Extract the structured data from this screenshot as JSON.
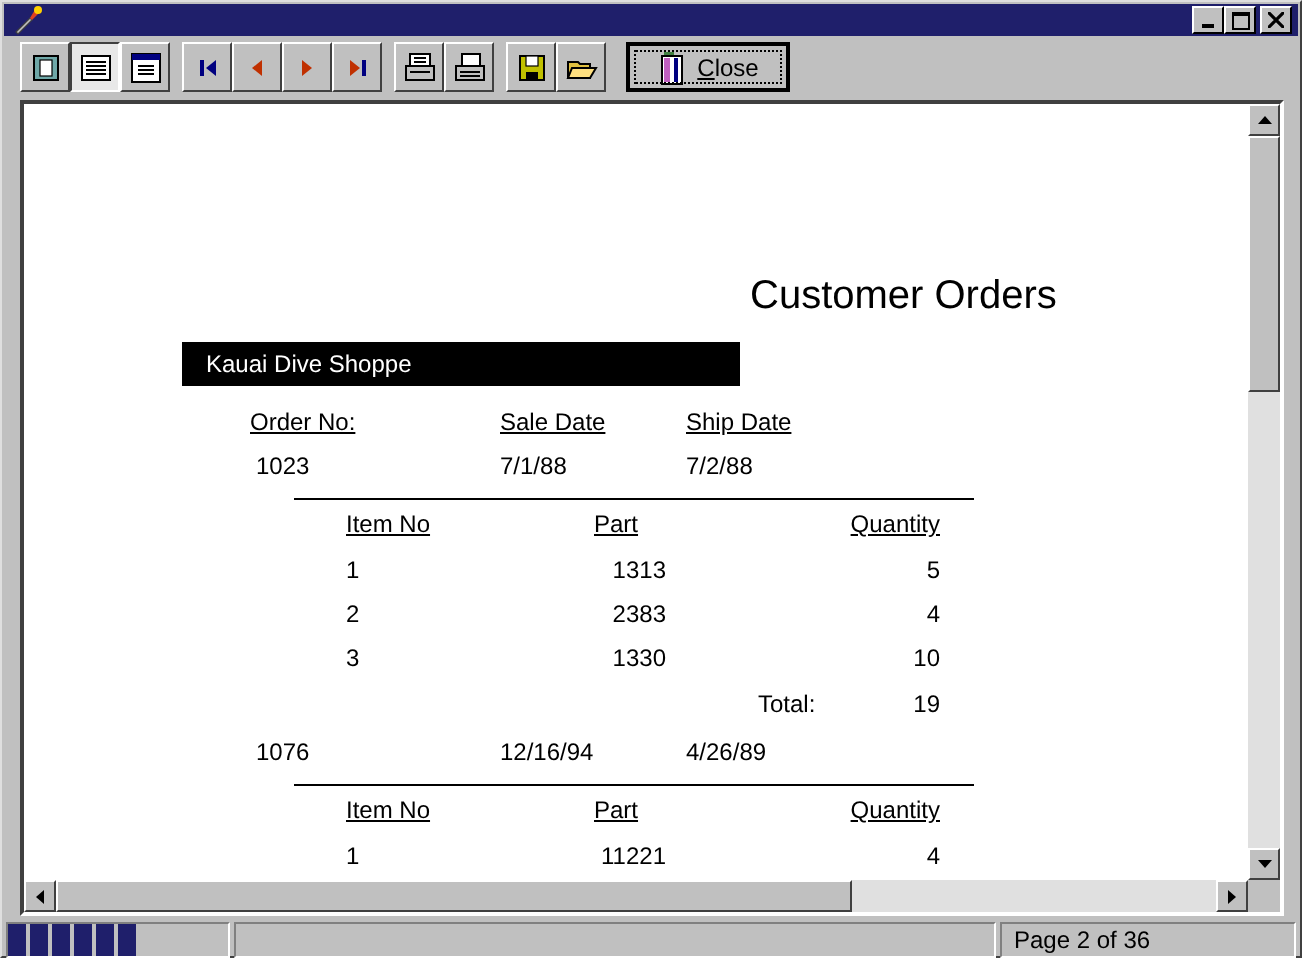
{
  "toolbar": {
    "groups": [
      [
        {
          "kind": "whole-page",
          "selected": false
        },
        {
          "kind": "page-width",
          "selected": true
        },
        {
          "kind": "zoom",
          "selected": false
        }
      ],
      [
        {
          "kind": "first"
        },
        {
          "kind": "prev"
        },
        {
          "kind": "next"
        },
        {
          "kind": "last"
        }
      ],
      [
        {
          "kind": "print-setup"
        },
        {
          "kind": "print"
        }
      ],
      [
        {
          "kind": "save"
        },
        {
          "kind": "open"
        }
      ]
    ],
    "close": {
      "label": "Close"
    }
  },
  "report": {
    "title": "Customer Orders",
    "customer": "Kauai Dive Shoppe",
    "order_columns": [
      "Order No:",
      "Sale Date",
      "Ship Date"
    ],
    "orders": [
      {
        "order_no": "1023",
        "sale_date": "7/1/88",
        "ship_date": "7/2/88",
        "item_columns": [
          "Item No",
          "Part",
          "Quantity"
        ],
        "items": [
          {
            "item_no": "1",
            "part": "1313",
            "quantity": "5"
          },
          {
            "item_no": "2",
            "part": "2383",
            "quantity": "4"
          },
          {
            "item_no": "3",
            "part": "1330",
            "quantity": "10"
          }
        ],
        "total": {
          "label": "Total:",
          "value": "19"
        }
      },
      {
        "order_no": "1076",
        "sale_date": "12/16/94",
        "ship_date": "4/26/89",
        "item_columns": [
          "Item No",
          "Part",
          "Quantity"
        ],
        "items": [
          {
            "item_no": "1",
            "part": "11221",
            "quantity": "4"
          }
        ]
      }
    ]
  },
  "status_bar": {
    "progress": {
      "level": 0.6
    },
    "page": "Page 2 of 36"
  }
}
